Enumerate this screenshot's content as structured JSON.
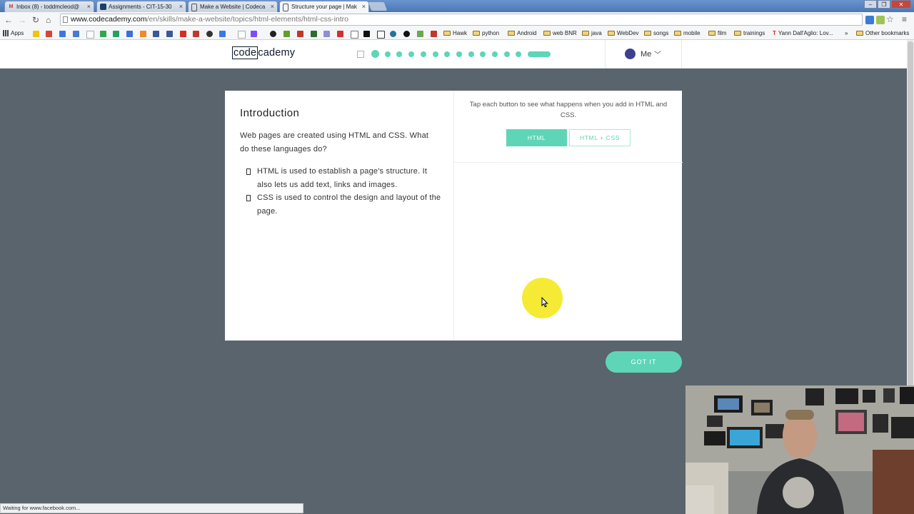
{
  "browser": {
    "tabs": [
      {
        "title": "Inbox (8) - toddmcleod@",
        "icon": "gmail-icon",
        "active": false
      },
      {
        "title": "Assignments - CIT-15-30",
        "icon": "page-icon",
        "active": false
      },
      {
        "title": "Make a Website | Codeca",
        "icon": "page-icon",
        "active": false
      },
      {
        "title": "Structure your page | Mak",
        "icon": "page-icon",
        "active": true
      }
    ],
    "tab_close": "×",
    "url_host": "www.codecademy.com",
    "url_path": "/en/skills/make-a-website/topics/html-elements/html-css-intro",
    "window_controls": [
      "–",
      "❐",
      "✕"
    ],
    "nav": {
      "back": "←",
      "forward": "→",
      "reload": "↻",
      "home": "⌂"
    },
    "bookmarks": [
      {
        "label": "Apps",
        "type": "apps"
      },
      {
        "label": "Hawk",
        "type": "folder"
      },
      {
        "label": "python",
        "type": "folder"
      },
      {
        "label": "Android",
        "type": "folder"
      },
      {
        "label": "web BNR",
        "type": "folder"
      },
      {
        "label": "java",
        "type": "folder"
      },
      {
        "label": "WebDev",
        "type": "folder"
      },
      {
        "label": "songs",
        "type": "folder"
      },
      {
        "label": "mobile",
        "type": "folder"
      },
      {
        "label": "film",
        "type": "folder"
      },
      {
        "label": "trainings",
        "type": "folder"
      },
      {
        "label": "Yann Dall'Aglio: Lov...",
        "type": "link"
      },
      {
        "label": "»",
        "type": "overflow"
      },
      {
        "label": "Other bookmarks",
        "type": "folder"
      }
    ],
    "status_text": "Waiting for www.facebook.com..."
  },
  "header": {
    "logo_boxed": "code",
    "logo_rest": "cademy",
    "progress_dots": 13,
    "progress_current": 1,
    "user_label": "Me",
    "user_chevron": "﹀"
  },
  "lesson": {
    "title": "Introduction",
    "intro": "Web pages are created using HTML and CSS. What do these languages do?",
    "bullets": [
      "HTML is used to establish a page's structure. It also lets us add text, links and images.",
      "CSS is used to control the design and layout of the page."
    ]
  },
  "demo": {
    "instruction": "Tap each button to see what happens when you add in HTML and CSS.",
    "buttons": [
      "HTML",
      "HTML + CSS"
    ],
    "selected": "HTML"
  },
  "cta": {
    "label": "GOT IT"
  },
  "colors": {
    "accent": "#5ed5b7",
    "background": "#5a646c",
    "cursor_highlight": "#f4ea2a"
  }
}
